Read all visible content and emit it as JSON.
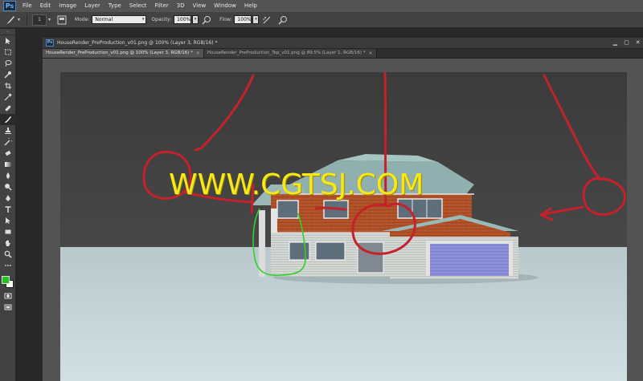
{
  "app": {
    "logo": "Ps",
    "menu": [
      "File",
      "Edit",
      "Image",
      "Layer",
      "Type",
      "Select",
      "Filter",
      "3D",
      "View",
      "Window",
      "Help"
    ]
  },
  "options_bar": {
    "brush_size": "1",
    "mode_label": "Mode:",
    "mode_value": "Normal",
    "opacity_label": "Opacity:",
    "opacity_value": "100%",
    "flow_label": "Flow:",
    "flow_value": "100%"
  },
  "toolbox": {
    "tools": [
      "move-tool",
      "marquee-tool",
      "lasso-tool",
      "quick-select-tool",
      "crop-tool",
      "eyedropper-tool",
      "healing-tool",
      "brush-tool",
      "stamp-tool",
      "history-brush-tool",
      "eraser-tool",
      "gradient-tool",
      "blur-tool",
      "dodge-tool",
      "pen-tool",
      "type-tool",
      "path-select-tool",
      "shape-tool",
      "hand-tool",
      "zoom-tool"
    ],
    "active_tool": "brush-tool",
    "foreground_color": "#21c41e",
    "background_color": "#ffffff"
  },
  "document": {
    "window_title": "HouseRender_PreProduction_v01.png @ 100% (Layer 3, RGB/16) *",
    "tabs": [
      {
        "label": "HouseRender_PreProduction_v01.png @ 100% (Layer 3, RGB/16) *",
        "active": true
      },
      {
        "label": "HouseRender_PreProduction_Top_v01.png @ 89.5% (Layer 1, RGB/16) *",
        "active": false
      }
    ],
    "close_glyph": "×"
  },
  "canvas": {
    "watermark": "WWW.CGTSJ.COM",
    "annotation_colors": {
      "red": "#c4222a",
      "green": "#2fd12a"
    }
  }
}
